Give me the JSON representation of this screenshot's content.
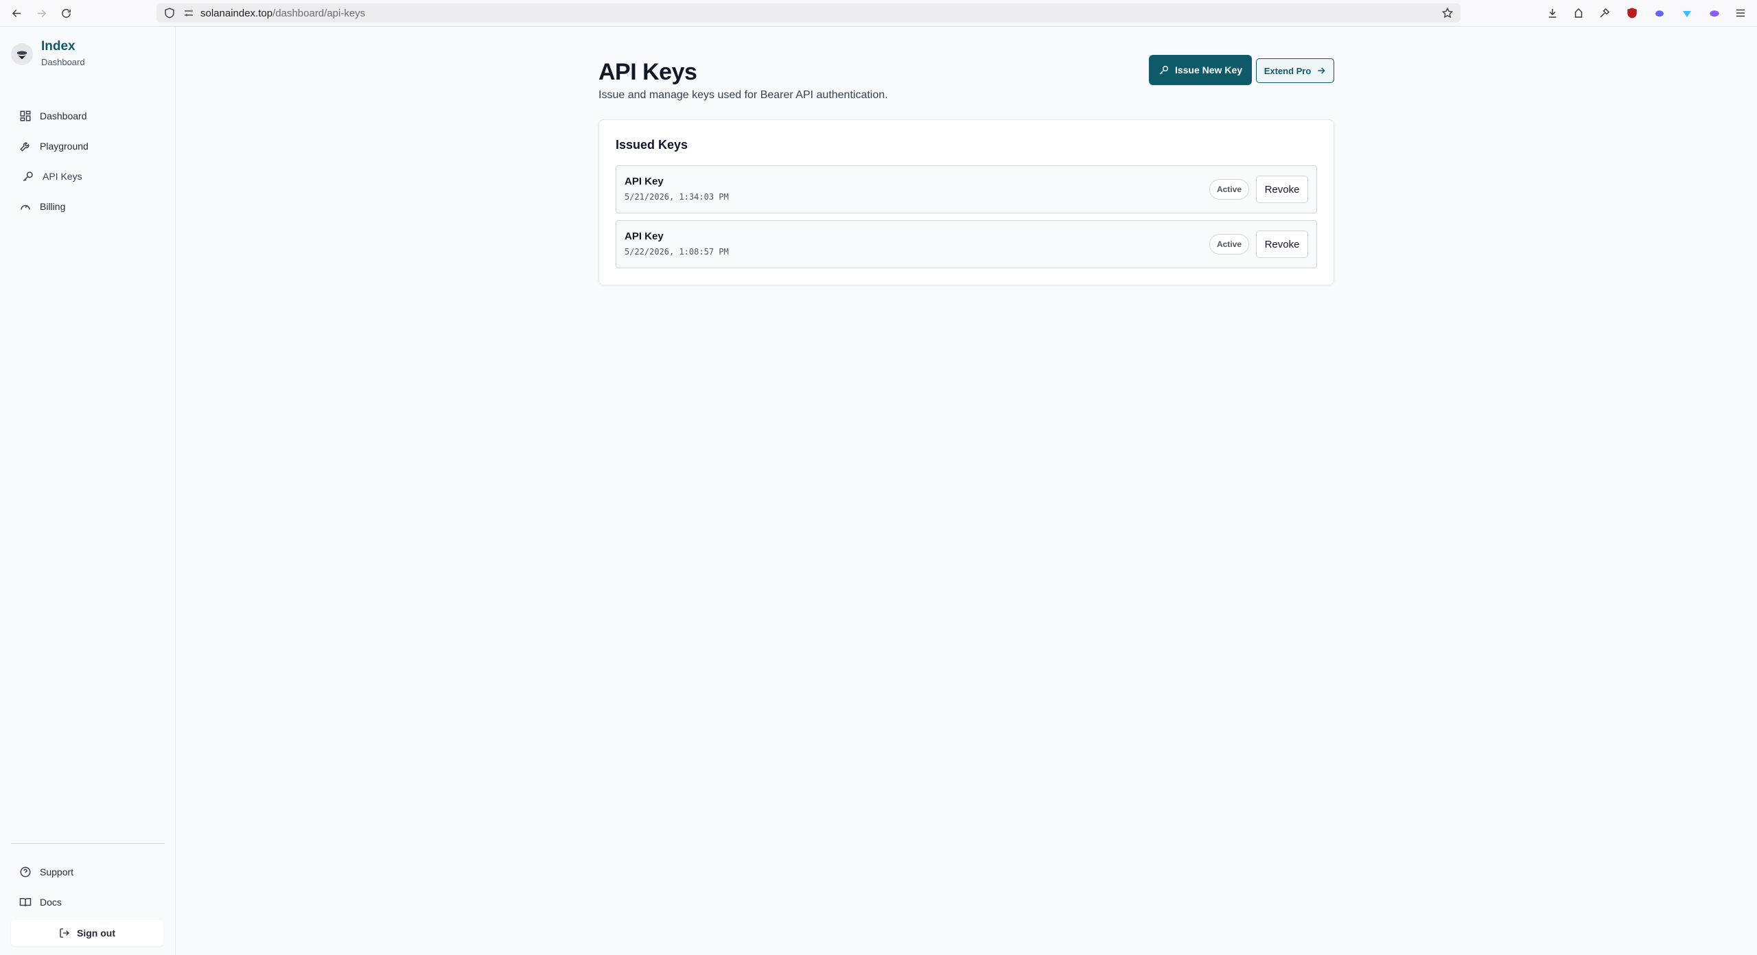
{
  "browser": {
    "url_host": "solanaindex.top",
    "url_path": "/dashboard/api-keys"
  },
  "sidebar": {
    "brand_title": "Index",
    "brand_subtitle": "Dashboard",
    "items": [
      {
        "label": "Dashboard",
        "icon": "grid-icon"
      },
      {
        "label": "Playground",
        "icon": "wrench-icon"
      },
      {
        "label": "API Keys",
        "icon": "key-icon",
        "active": true
      },
      {
        "label": "Billing",
        "icon": "gauge-icon"
      }
    ],
    "footer_items": [
      {
        "label": "Support",
        "icon": "help-circle-icon"
      },
      {
        "label": "Docs",
        "icon": "book-icon"
      }
    ],
    "signout_label": "Sign out"
  },
  "main": {
    "title": "API Keys",
    "subtitle": "Issue and manage keys used for Bearer API authentication.",
    "issue_button": "Issue New Key",
    "extend_button": "Extend Pro",
    "card_title": "Issued Keys",
    "keys": [
      {
        "name": "API Key",
        "created": "5/21/2026, 1:34:03 PM",
        "status": "Active",
        "action": "Revoke"
      },
      {
        "name": "API Key",
        "created": "5/22/2026, 1:08:57 PM",
        "status": "Active",
        "action": "Revoke"
      }
    ]
  },
  "colors": {
    "brand": "#0e5a6b",
    "background": "#f8fafc"
  }
}
